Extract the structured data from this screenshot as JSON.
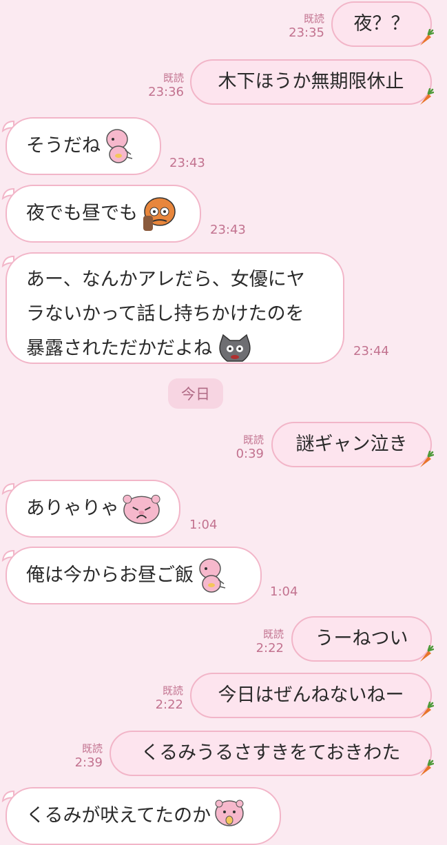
{
  "colors": {
    "background": "#FBEAF1",
    "incoming_bubble": "#FFFFFF",
    "outgoing_bubble": "#FDE4EE",
    "border": "#F2B5C8",
    "meta_text": "#C2728F"
  },
  "messages": [
    {
      "dir": "out",
      "text": "夜？？",
      "read": "既読",
      "time": "23:35"
    },
    {
      "dir": "out",
      "text": "木下ほうか無期限休止",
      "read": "既読",
      "time": "23:36"
    },
    {
      "dir": "in",
      "text": "そうだね",
      "sticker": "pink-creature-sticker",
      "time": "23:43"
    },
    {
      "dir": "in",
      "text": "夜でも昼でも",
      "sticker": "tiger-face-sticker",
      "time": "23:43"
    },
    {
      "dir": "in",
      "lines": [
        "あー、なんかアレだら、女優にヤ",
        "ラないかって話し持ちかけたのを",
        "暴露されただかだよね"
      ],
      "sticker": "gray-cat-sticker",
      "time": "23:44"
    },
    {
      "dir": "out",
      "text": "謎ギャン泣き",
      "read": "既読",
      "time": "0:39"
    },
    {
      "dir": "in",
      "text": "ありゃりゃ",
      "sticker": "pink-pig-face-sticker",
      "time": "1:04"
    },
    {
      "dir": "in",
      "text": "俺は今からお昼ご飯",
      "sticker": "pink-creature-sticker",
      "time": "1:04"
    },
    {
      "dir": "out",
      "text": "うーねつい",
      "read": "既読",
      "time": "2:22"
    },
    {
      "dir": "out",
      "text": "今日はぜんねないねー",
      "read": "既読",
      "time": "2:22"
    },
    {
      "dir": "out",
      "text": "くるみうるさすきをておきわた",
      "read": "既読",
      "time": "2:39"
    },
    {
      "dir": "in",
      "text": "くるみが吠えてたのか",
      "sticker": "pink-bear-sticker"
    }
  ],
  "date_divider": "今日"
}
